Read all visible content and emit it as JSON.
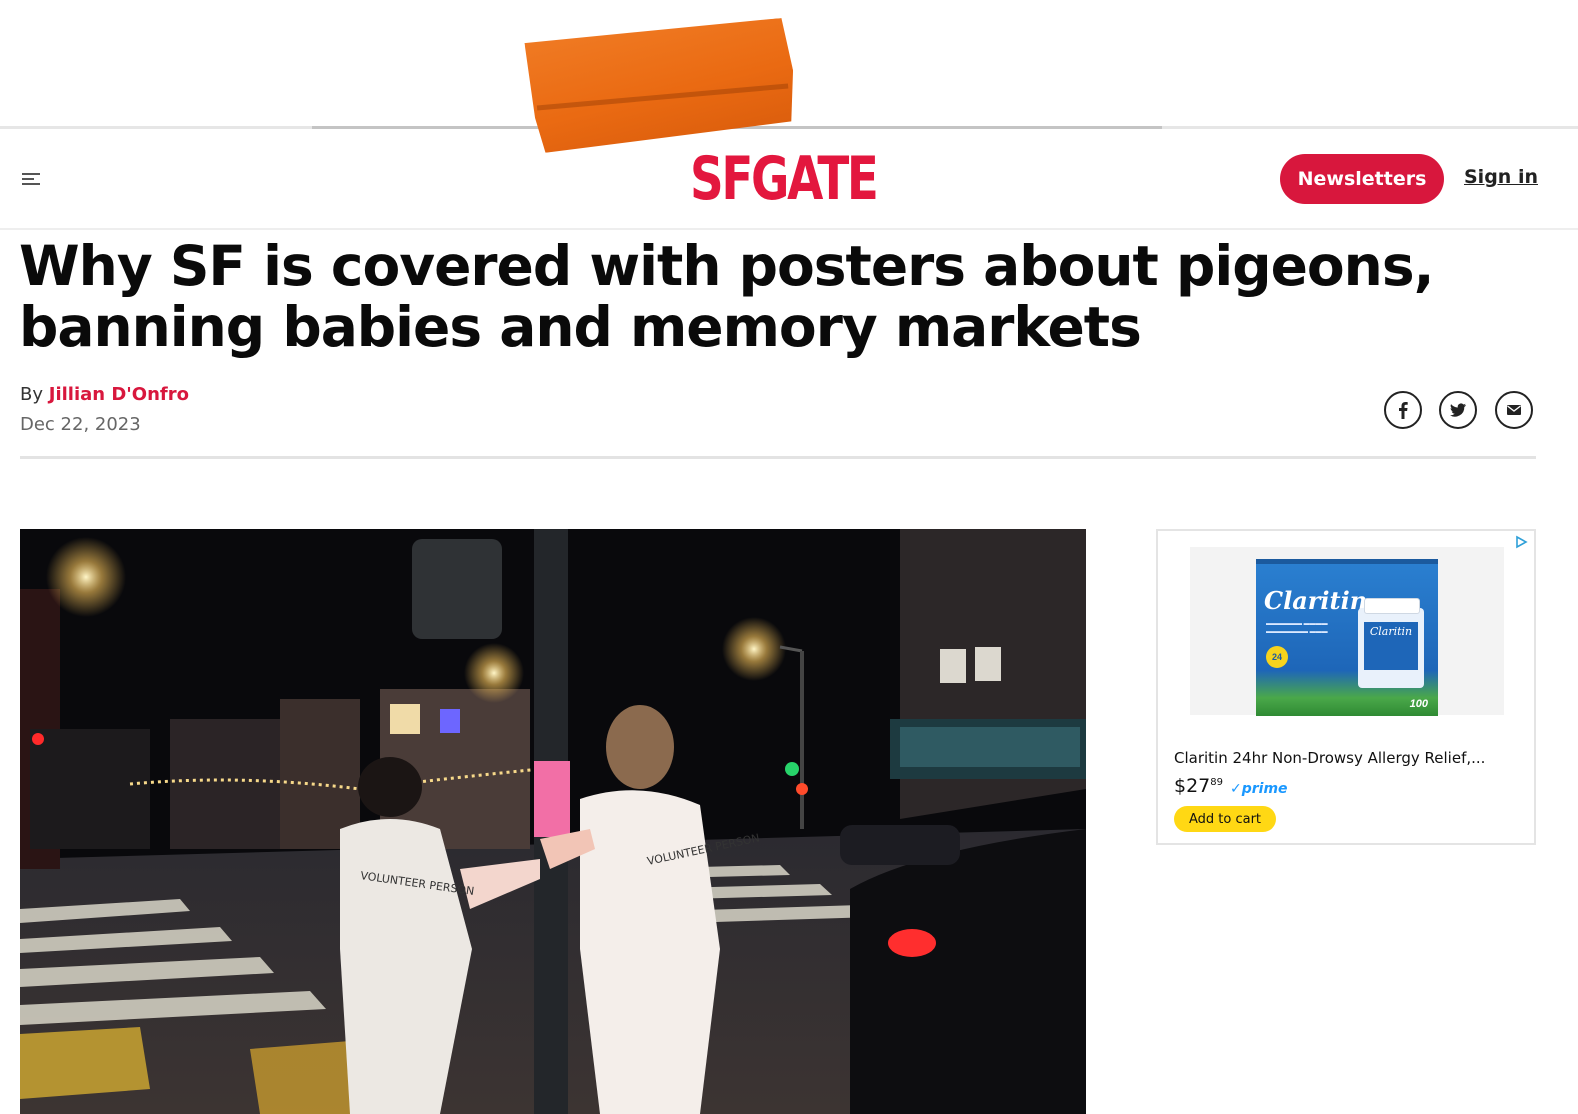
{
  "header": {
    "logo_text": "SFGATE",
    "newsletters_label": "Newsletters",
    "signin_label": "Sign in",
    "brand_color": "#d8173d"
  },
  "article": {
    "headline": "Why SF is covered with posters about pigeons, banning babies and memory markets",
    "byline_prefix": "By",
    "author": "Jillian D'Onfro",
    "date": "Dec 22, 2023",
    "share": [
      "facebook-icon",
      "twitter-icon",
      "email-icon"
    ]
  },
  "photo": {
    "vest_left": "VOLUNTEER PERSON",
    "vest_right": "VOLUNTEER PERSON"
  },
  "ad": {
    "product_brand": "Claritin",
    "product_count": "100",
    "badge": "24",
    "title": "Claritin 24hr Non-Drowsy Allergy Relief,...",
    "price_dollars": "$27",
    "price_cents": "89",
    "prime_label": "✓prime",
    "cart_label": "Add to cart"
  }
}
